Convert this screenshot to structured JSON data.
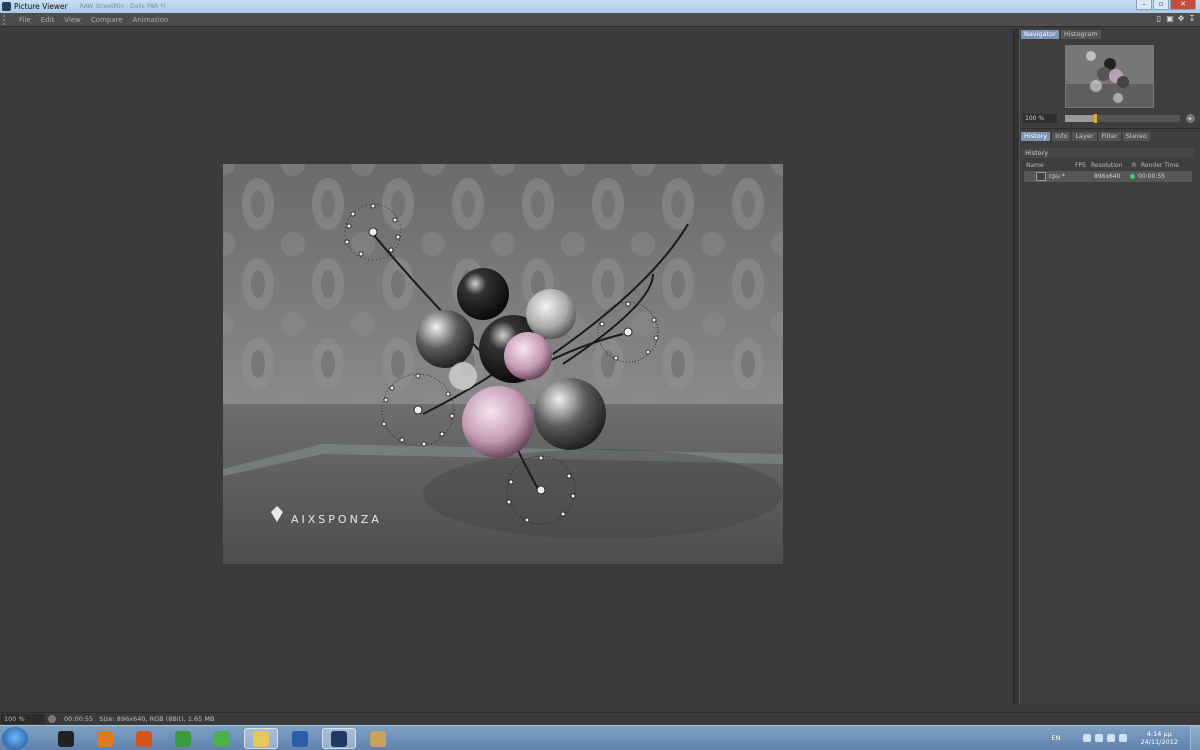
{
  "window": {
    "title": "Picture Viewer",
    "blurred_title": "RAW StreetMin - Dalis PAR *)"
  },
  "menu": [
    "File",
    "Edit",
    "View",
    "Compare",
    "Animation"
  ],
  "render": {
    "watermark": "AIXSPONZA"
  },
  "sidepanel": {
    "top_tabs": [
      "Navigator",
      "Histogram"
    ],
    "zoom": "100 %",
    "zoom_slider_fraction": 0.25,
    "bottom_tabs": [
      "History",
      "Info",
      "Layer",
      "Filter",
      "Stereo"
    ],
    "section_title": "History",
    "history_columns": [
      "Name",
      "FPS",
      "Resolution",
      "R",
      "Render Time"
    ],
    "history_rows": [
      {
        "name": "cpu *",
        "fps": "",
        "resolution": "896x640",
        "render_time": "00:00:55",
        "status_color": "#35d27a"
      }
    ]
  },
  "statusbar": {
    "zoom": "100 %",
    "time": "00:00:55",
    "info": "Size: 896x640, RGB (8Bit), 1.65 MB"
  },
  "taskbar": {
    "apps": [
      {
        "icon": "app-icon",
        "color": "#222222"
      },
      {
        "icon": "media-player-icon",
        "color": "#e07b1e"
      },
      {
        "icon": "firefox-icon",
        "color": "#d5561c"
      },
      {
        "icon": "chrome-icon",
        "color": "#3a9b3f"
      },
      {
        "icon": "utorrent-icon",
        "color": "#4caf50"
      },
      {
        "icon": "explorer-icon",
        "color": "#e6c75a"
      },
      {
        "icon": "pattern-icon",
        "color": "#2a5fa8"
      },
      {
        "icon": "cinema4d-icon",
        "color": "#1e3a66"
      },
      {
        "icon": "paint-icon",
        "color": "#c8a060"
      }
    ],
    "lang": "EN",
    "time": "4:14 μμ",
    "date": "24/11/2012"
  }
}
